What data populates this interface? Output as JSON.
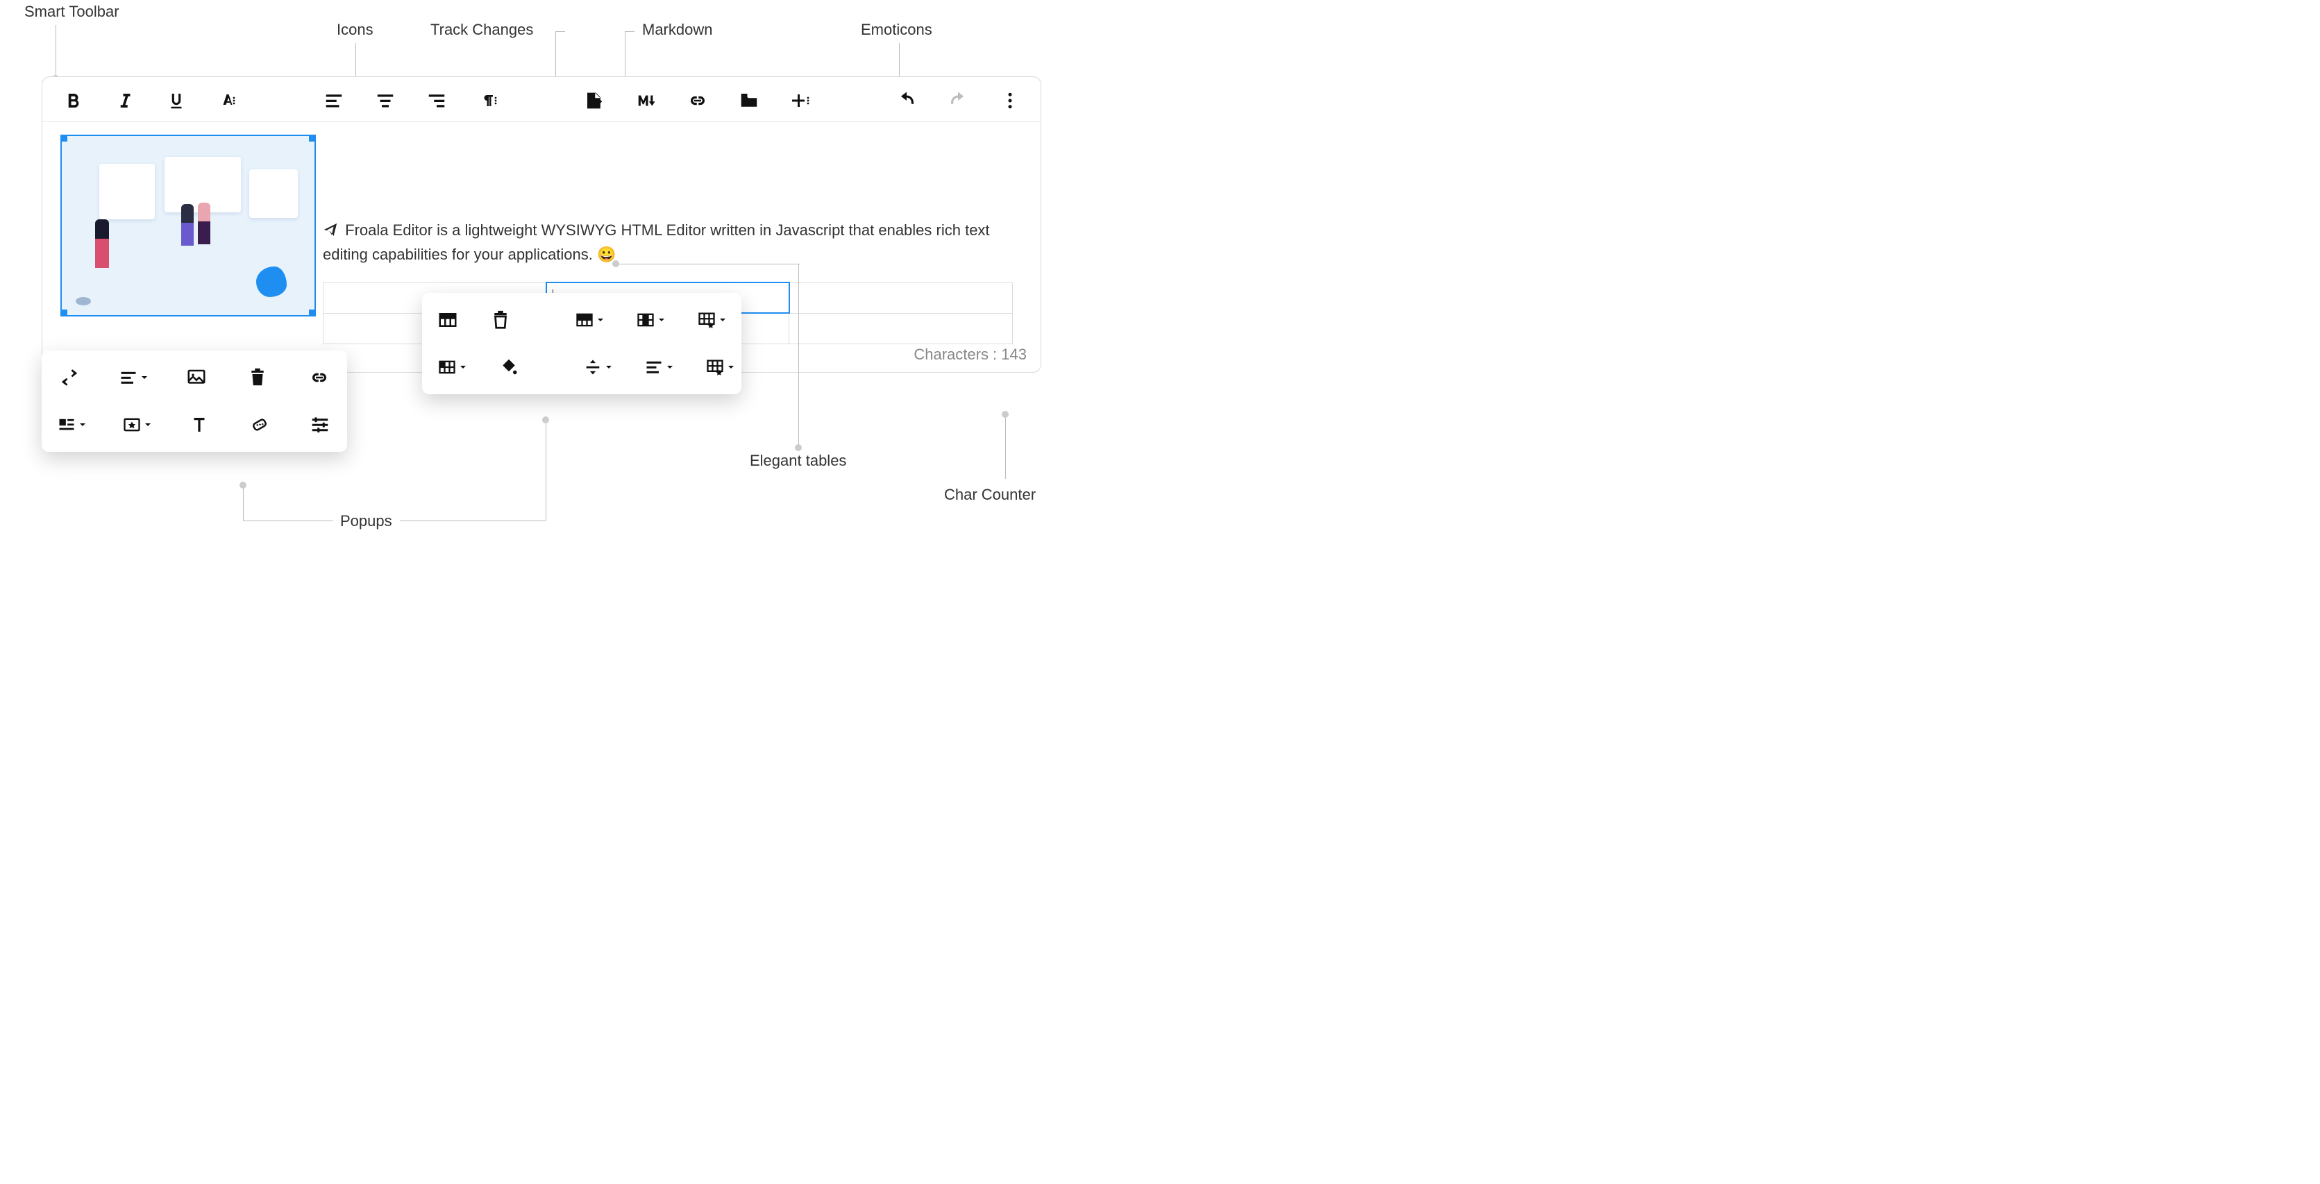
{
  "callouts": {
    "smart_toolbar": "Smart Toolbar",
    "icons": "Icons",
    "track_changes": "Track Changes",
    "markdown": "Markdown",
    "emoticons": "Emoticons",
    "popups": "Popups",
    "elegant_tables": "Elegant tables",
    "char_counter": "Char Counter"
  },
  "toolbar": {
    "buttons": [
      "bold",
      "italic",
      "underline",
      "text-color-more",
      "align-left",
      "align-center",
      "align-right",
      "paragraph-format-more",
      "track-changes",
      "markdown",
      "insert-link",
      "files",
      "insert-more",
      "undo",
      "redo",
      "more-ellipsis"
    ]
  },
  "content": {
    "paragraph": "Froala Editor is a lightweight WYSIWYG HTML Editor written in Javascript that enables rich text editing capabilities for your applications.",
    "emoji": "😀",
    "table": {
      "rows": 2,
      "cols": 3,
      "active_cell": [
        0,
        1
      ]
    }
  },
  "image_popup": {
    "row1": [
      "replace",
      "align-dropdown",
      "image-caption",
      "delete",
      "link"
    ],
    "row2": [
      "display-dropdown",
      "style-dropdown",
      "alt-text",
      "size",
      "advanced-edit"
    ]
  },
  "table_popup": {
    "row1": [
      "table-header",
      "remove-table",
      "row-dropdown",
      "column-dropdown",
      "table-style-dropdown"
    ],
    "row2": [
      "cell-dropdown",
      "cell-background",
      "vertical-align-dropdown",
      "horizontal-align-dropdown",
      "cell-style-dropdown"
    ]
  },
  "footer": {
    "char_label": "Characters : ",
    "char_count": "143"
  }
}
